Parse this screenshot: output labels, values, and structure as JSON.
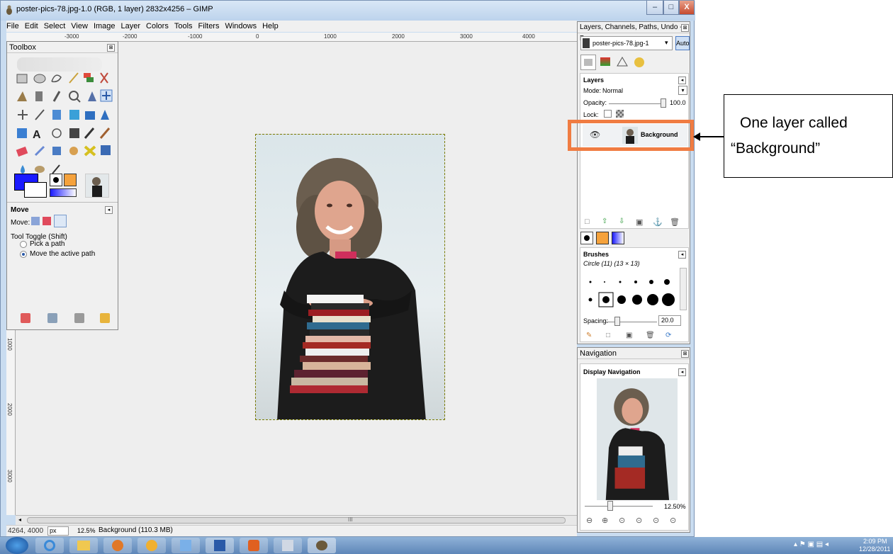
{
  "window": {
    "title": "poster-pics-78.jpg-1.0 (RGB, 1 layer) 2832x4256 – GIMP",
    "minimize": "–",
    "maximize": "□",
    "close": "X"
  },
  "menu": [
    "File",
    "Edit",
    "Select",
    "View",
    "Image",
    "Layer",
    "Colors",
    "Tools",
    "Filters",
    "Windows",
    "Help"
  ],
  "ruler_top": [
    "-3000",
    "-2000",
    "-1000",
    "0",
    "1000",
    "2000",
    "3000",
    "4000"
  ],
  "ruler_left": [
    "1000",
    "2000",
    "3000"
  ],
  "toolbox": {
    "title": "Toolbox",
    "tool_options_title": "Move",
    "move_label": "Move:",
    "toggle_label": "Tool Toggle  (Shift)",
    "radio_1": "Pick a path",
    "radio_2": "Move the active path"
  },
  "statusbar": {
    "coords": "4264, 4000",
    "unit": "px",
    "zoom": "12.5%",
    "message": "Background (110.3 MB)"
  },
  "hscroll_mark": "III",
  "layers_dock": {
    "title": "Layers, Channels, Paths, Undo - B...",
    "image_select": "poster-pics-78.jpg-1",
    "auto_button": "Auto",
    "section": "Layers",
    "mode_label": "Mode:",
    "mode_value": "Normal",
    "opacity_label": "Opacity:",
    "opacity_value": "100.0",
    "opacity_fraction": 1.0,
    "lock_label": "Lock:",
    "layer_name": "Background"
  },
  "brushes": {
    "section": "Brushes",
    "brush_name": "Circle (11) (13 × 13)",
    "spacing_label": "Spacing:",
    "spacing_value": "20.0"
  },
  "navigation": {
    "title": "Navigation",
    "section": "Display Navigation",
    "zoom_value": "12.50%"
  },
  "taskbar": {
    "time": "2:09 PM",
    "date": "12/28/2011"
  },
  "annotation": {
    "line1": "One layer called",
    "line2": "“Background”"
  },
  "colors": {
    "highlight": "#f07c42",
    "fg_color": "#1a1aff",
    "bg_color": "#ffffff"
  }
}
